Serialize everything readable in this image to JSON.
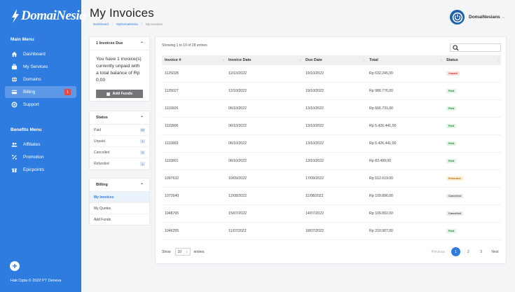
{
  "brand": {
    "name": "DomaiNesia",
    "accent": "#2f7ce0"
  },
  "sidebar": {
    "main_menu_title": "Main Menu",
    "main_items": [
      {
        "label": "Dashboard",
        "icon": "home-icon"
      },
      {
        "label": "My Services",
        "icon": "briefcase-icon"
      },
      {
        "label": "Domains",
        "icon": "globe-icon"
      },
      {
        "label": "Billing",
        "icon": "billing-icon",
        "badge": "1",
        "active": true
      },
      {
        "label": "Support",
        "icon": "lifebuoy-icon"
      }
    ],
    "benefits_menu_title": "Benefits Menu",
    "benefit_items": [
      {
        "label": "Affiliates",
        "icon": "users-icon"
      },
      {
        "label": "Promotion",
        "icon": "percent-icon"
      },
      {
        "label": "Epicpoints",
        "icon": "gift-icon"
      }
    ],
    "fab_label": "+",
    "copyright": "Hak Cipta © 2022 PT Deneva"
  },
  "header": {
    "title": "My Invoices",
    "breadcrumb": [
      "Dashboard",
      "MyDomaiNesia",
      "My Invoices"
    ],
    "user_name": "DomaiNesians"
  },
  "due_panel": {
    "title": "1 Invoices Due",
    "text": "You have 1 invoice(s) currently unpaid with a total balance of Rp 0.00",
    "button": "Add Funds"
  },
  "status_panel": {
    "title": "Status",
    "items": [
      {
        "label": "Paid",
        "count": "22"
      },
      {
        "label": "Unpaid",
        "count": "1"
      },
      {
        "label": "Cancelled",
        "count": "3"
      },
      {
        "label": "Refunded",
        "count": "1"
      }
    ]
  },
  "billing_panel": {
    "title": "Billing",
    "items": [
      {
        "label": "My Invoices",
        "active": true
      },
      {
        "label": "My Quotes"
      },
      {
        "label": "Add Funds"
      }
    ]
  },
  "table": {
    "showing": "Showing 1 to 10 of 28 entries",
    "search_placeholder": "",
    "columns": [
      "Invoice #",
      "Invoice Date",
      "Due Date",
      "Total",
      "Status"
    ],
    "rows": [
      {
        "id": "1125028",
        "date": "12/10/2022",
        "due": "19/10/2022",
        "total": "Rp 632.245,00",
        "status": "Unpaid",
        "cls": "b-unpaid"
      },
      {
        "id": "1125027",
        "date": "12/10/2022",
        "due": "19/10/2022",
        "total": "Rp 986.776,00",
        "status": "Paid",
        "cls": "b-paid"
      },
      {
        "id": "1119926",
        "date": "06/10/2022",
        "due": "13/10/2022",
        "total": "Rp 666.731,00",
        "status": "Paid",
        "cls": "b-paid"
      },
      {
        "id": "1119906",
        "date": "06/10/2022",
        "due": "13/10/2022",
        "total": "Rp 5.426.441,00",
        "status": "Paid",
        "cls": "b-paid"
      },
      {
        "id": "1119903",
        "date": "06/10/2022",
        "due": "13/10/2022",
        "total": "Rp 5.426.441,00",
        "status": "Paid",
        "cls": "b-paid"
      },
      {
        "id": "1119901",
        "date": "06/10/2022",
        "due": "13/10/2022",
        "total": "Rp 83.499,00",
        "status": "Paid",
        "cls": "b-paid"
      },
      {
        "id": "1097632",
        "date": "10/09/2022",
        "due": "17/09/2022",
        "total": "Rp 512.619,00",
        "status": "Refunded",
        "cls": "b-refunded"
      },
      {
        "id": "1072640",
        "date": "12/08/2022",
        "due": "11/08/2022",
        "total": "Rp 109.896,00",
        "status": "Cancelled",
        "cls": "b-cancelled"
      },
      {
        "id": "1048765",
        "date": "15/07/2022",
        "due": "14/07/2022",
        "total": "Rp 109.892,00",
        "status": "Cancelled",
        "cls": "b-cancelled"
      },
      {
        "id": "1046255",
        "date": "11/07/2022",
        "due": "18/07/2022",
        "total": "Rp 210.907,00",
        "status": "Paid",
        "cls": "b-paid"
      }
    ],
    "show_label": "Show",
    "entries_value": "10",
    "entries_label": "entries",
    "pagination": {
      "previous": "Previous",
      "pages": [
        "1",
        "2",
        "3"
      ],
      "current": "1",
      "next": "Next"
    }
  }
}
